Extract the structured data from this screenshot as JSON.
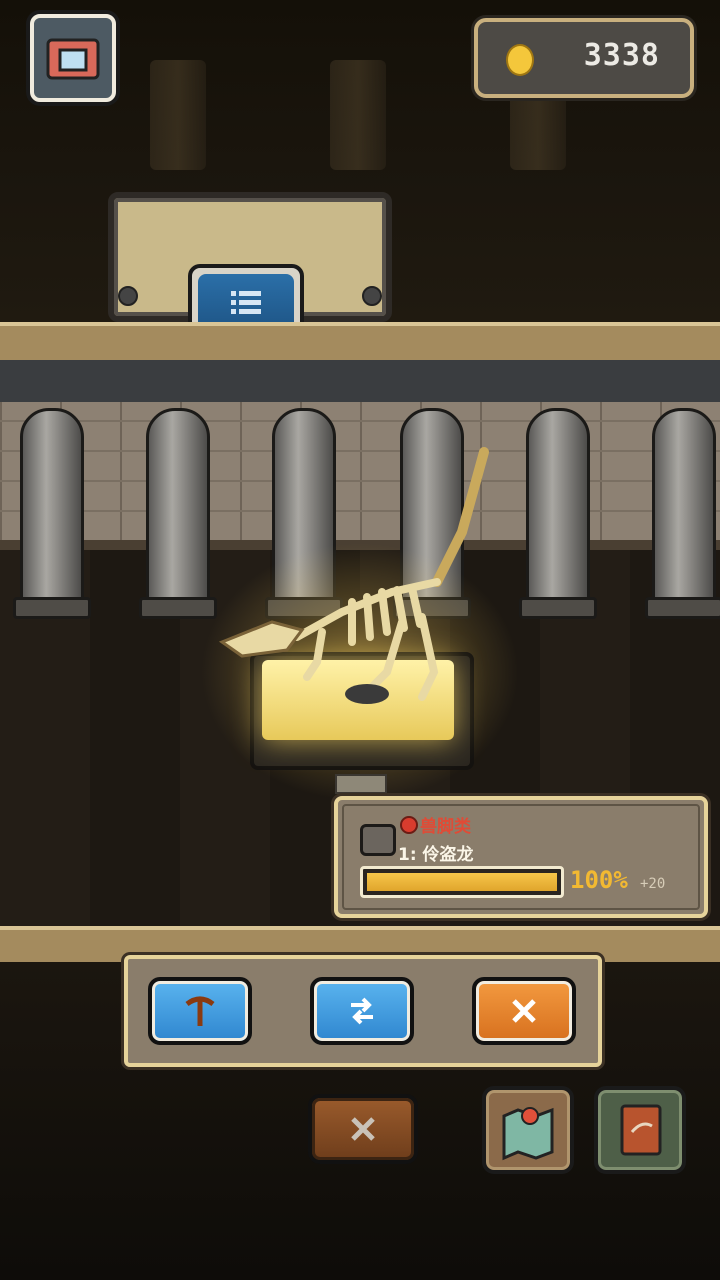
{
  "hud": {
    "coin_amount": "3338"
  },
  "exhibit": {
    "category": "兽脚类",
    "species": "1: 伶盗龙",
    "progress_fraction": 1.0,
    "progress_text": "100%",
    "progress_bonus": "+20"
  },
  "icons": {
    "camera": "camera-icon",
    "coin": "coin-icon",
    "list": "list-icon",
    "dig": "pickaxe-icon",
    "swap": "swap-arrows-icon",
    "close": "close-icon",
    "map": "map-icon",
    "book": "book-icon",
    "fossil": "fossil-icon"
  },
  "colors": {
    "category_dot": "#d83c2e",
    "progress_fill": "#f2b932",
    "blue_button": "#3a94da",
    "orange_button": "#e6832c"
  }
}
